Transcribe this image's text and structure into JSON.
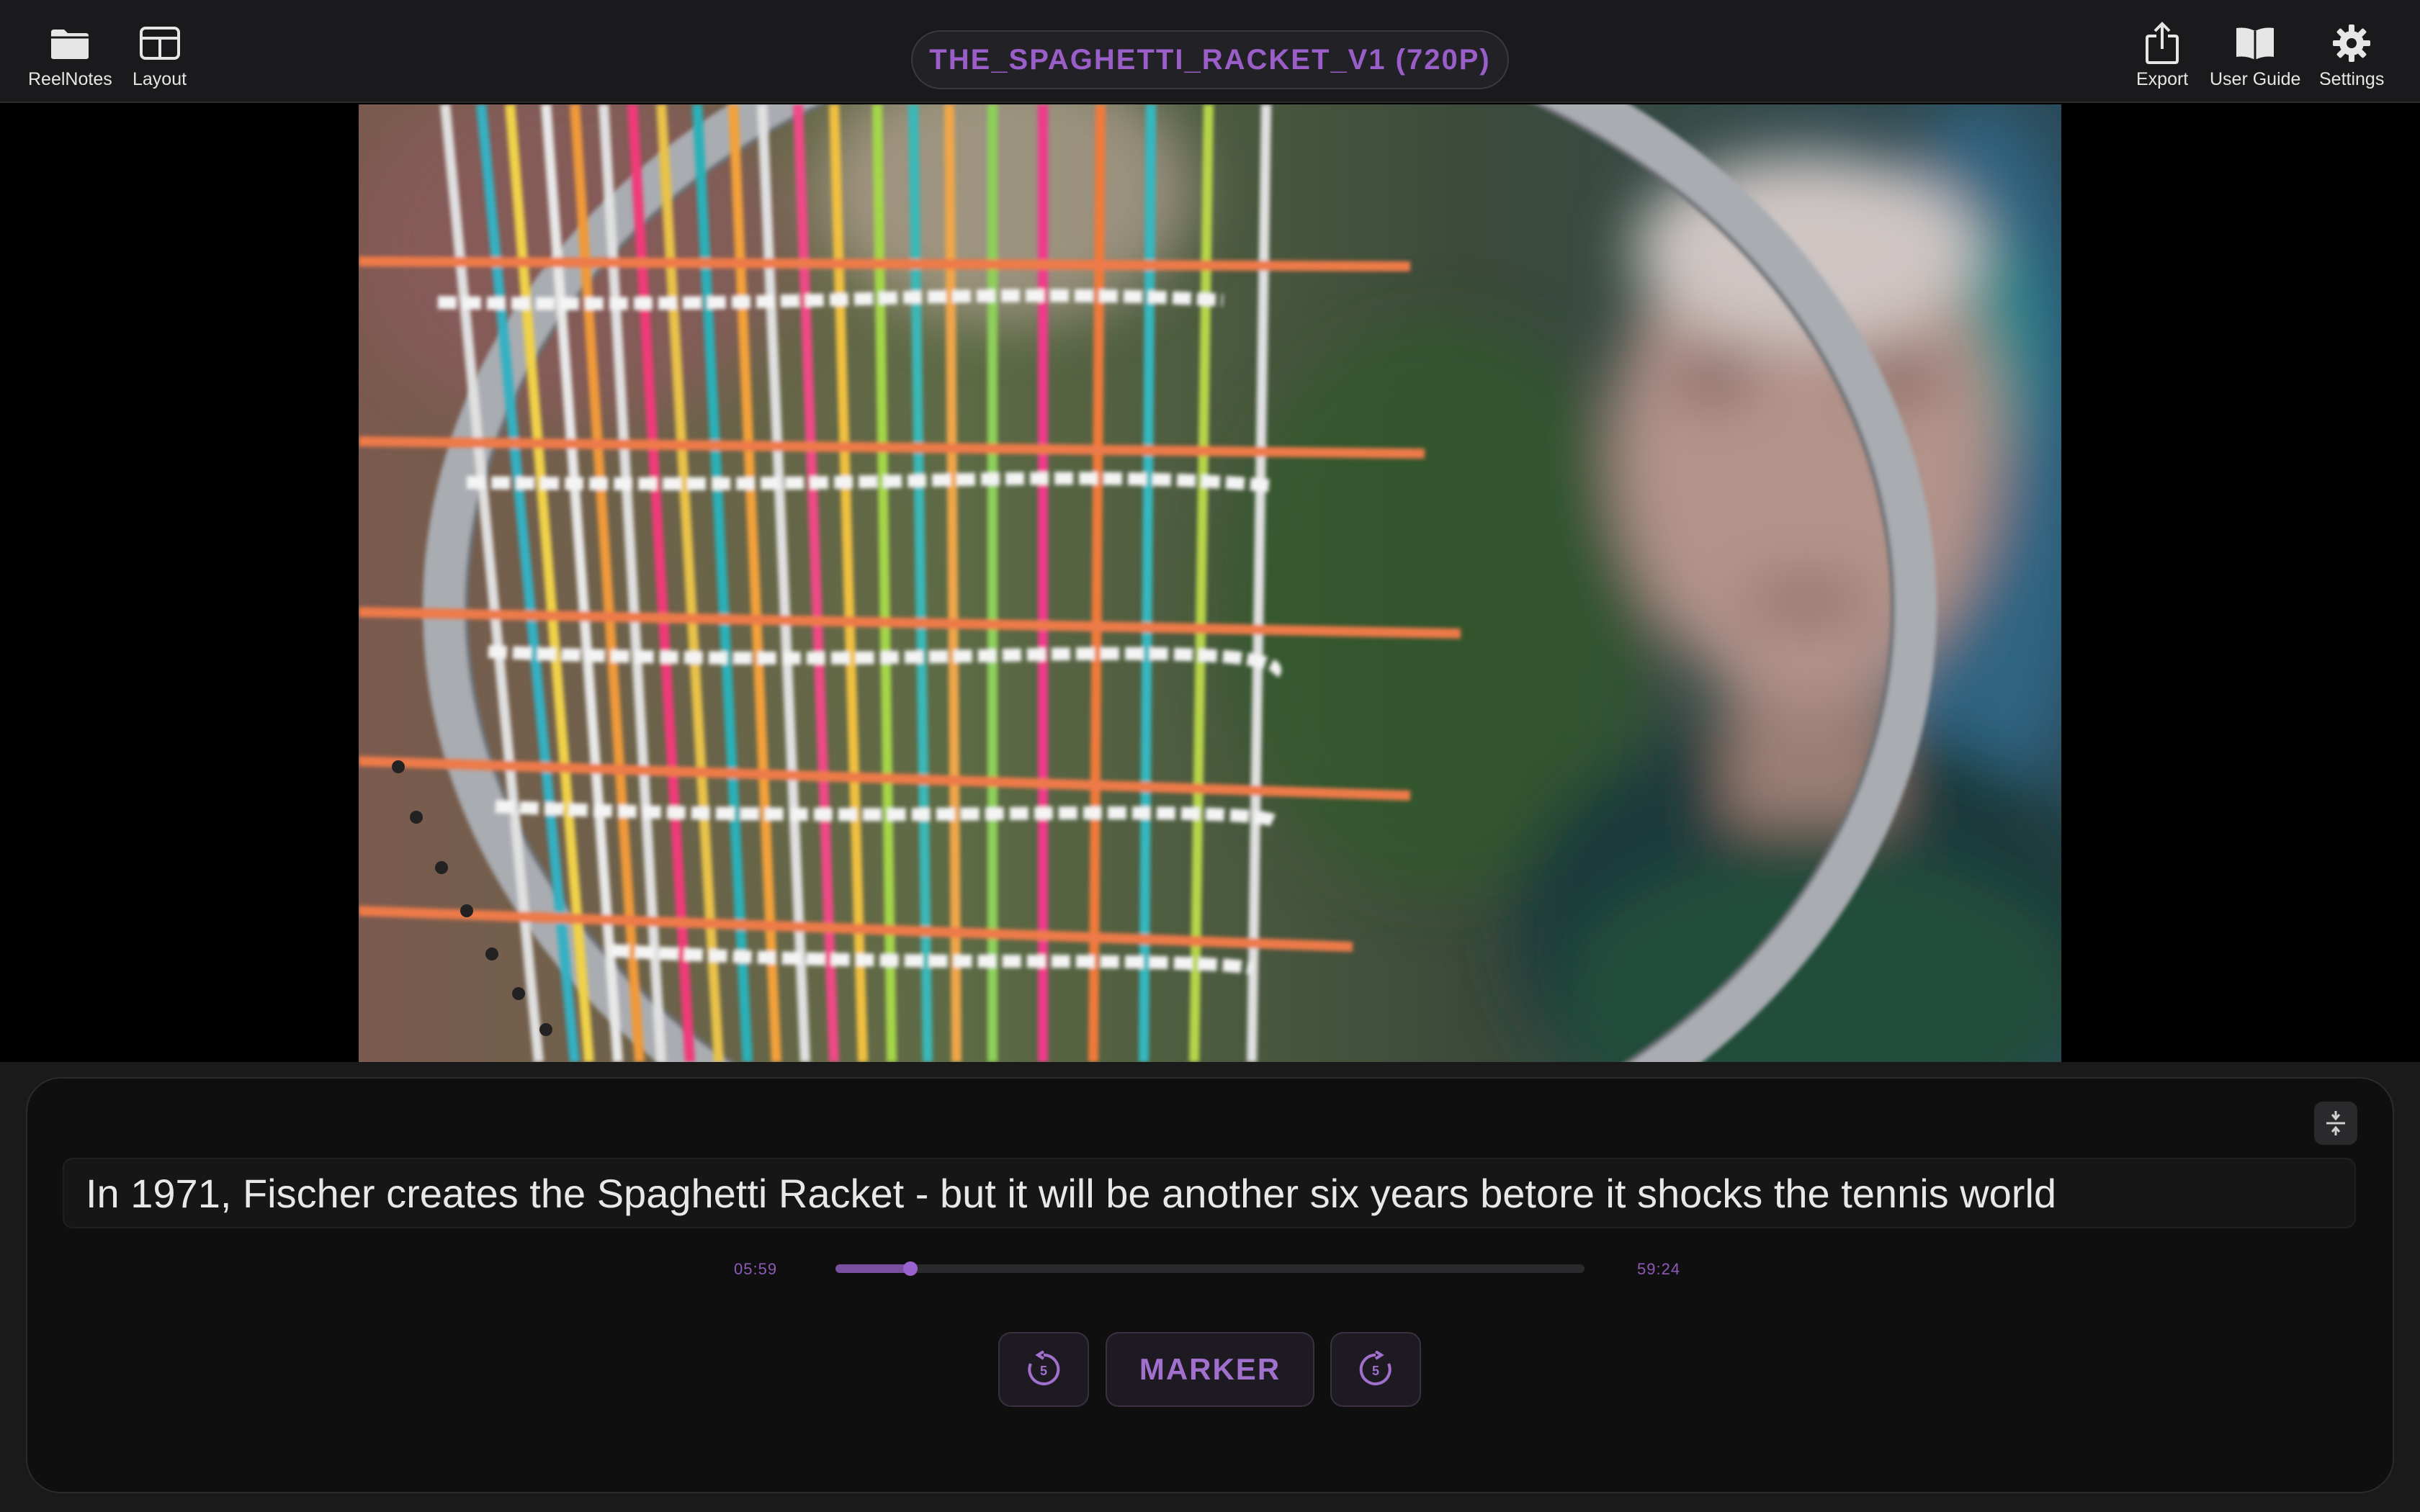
{
  "toolbar": {
    "left": [
      {
        "label": "ReelNotes",
        "icon": "folder-icon"
      },
      {
        "label": "Layout",
        "icon": "layout-icon"
      }
    ],
    "right": [
      {
        "label": "Export",
        "icon": "share-icon"
      },
      {
        "label": "User Guide",
        "icon": "book-icon"
      },
      {
        "label": "Settings",
        "icon": "gear-icon"
      }
    ]
  },
  "title": "THE_SPAGHETTI_RACKET_V1 (720P)",
  "video": {
    "description_icon": "video-frame"
  },
  "caption": "In 1971, Fischer creates the Spaghetti Racket - but it will be another six years betore it shocks the tennis world",
  "playback": {
    "current_time": "05:59",
    "total_time": "59:24",
    "progress": 0.1
  },
  "controls": {
    "rewind_seconds": "5",
    "marker_label": "MARKER",
    "forward_seconds": "5"
  },
  "colors": {
    "accent": "#9a5ec8",
    "panel": "#0f0f10",
    "topbar": "#1a1a1c"
  }
}
